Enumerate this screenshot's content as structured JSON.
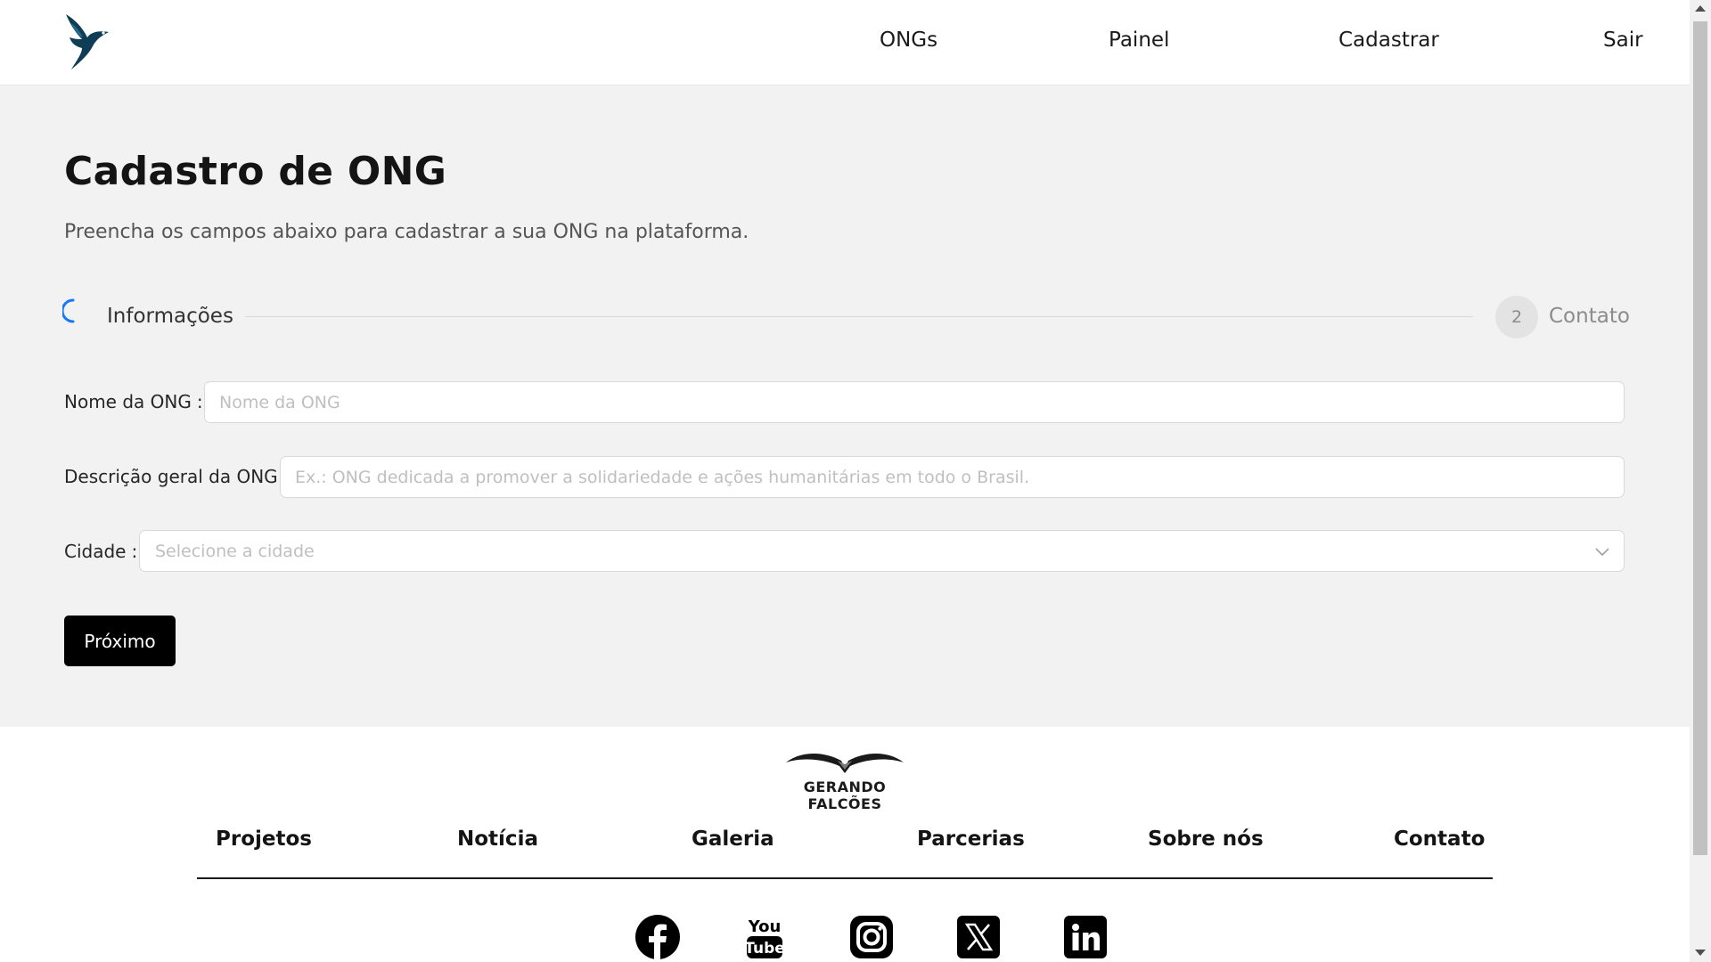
{
  "header": {
    "logo_icon": "bird-logo-icon",
    "nav": {
      "ongs": "ONGs",
      "painel": "Painel",
      "cadastrar": "Cadastrar",
      "sair": "Sair"
    }
  },
  "main": {
    "title": "Cadastro de ONG",
    "subtitle": "Preencha os campos abaixo para cadastrar a sua ONG na plataforma.",
    "steps": [
      {
        "label": "Informações",
        "state": "in-progress"
      },
      {
        "number": "2",
        "label": "Contato",
        "state": "waiting"
      }
    ],
    "form": {
      "nome": {
        "label": "Nome da ONG",
        "colon": ":",
        "value": "",
        "placeholder": "Nome da ONG"
      },
      "descricao": {
        "label": "Descrição geral da ONG",
        "colon": ":",
        "value": "",
        "placeholder": "Ex.: ONG dedicada a promover a solidariedade e ações humanitárias em todo o Brasil."
      },
      "cidade": {
        "label": "Cidade",
        "colon": ":",
        "placeholder": "Selecione a cidade"
      },
      "next_button": "Próximo"
    }
  },
  "footer": {
    "brand": "GERANDO FALCÕES",
    "links": {
      "projetos": "Projetos",
      "noticia": "Notícia",
      "galeria": "Galeria",
      "parcerias": "Parcerias",
      "sobre": "Sobre nós",
      "contato": "Contato"
    },
    "social": [
      "facebook-icon",
      "youtube-icon",
      "instagram-icon",
      "x-icon",
      "linkedin-icon"
    ]
  },
  "colors": {
    "accent": "#1677ff",
    "button_bg": "#000000",
    "main_bg": "#f2f2f2"
  }
}
